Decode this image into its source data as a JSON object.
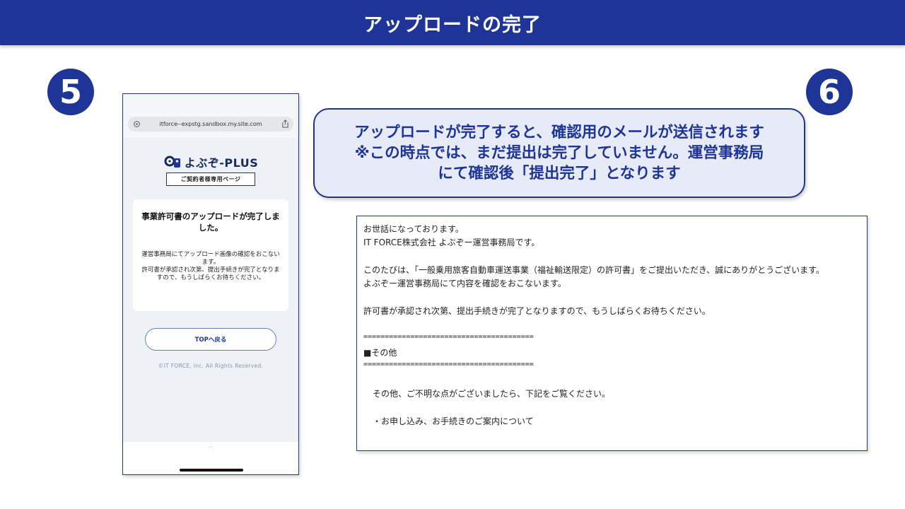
{
  "page": {
    "title": "アップロードの完了"
  },
  "badges": {
    "step5": "5",
    "step6": "6"
  },
  "phone": {
    "url": "itforce--expstg.sandbox.my.site.com",
    "logo": "よぶぞ-PLUS",
    "members_page": "ご契約者様専用ページ",
    "card_heading": "事業許可書のアップロードが完了しました。",
    "card_body": "運営事務局にてアップロード画像の確認をおこないます。\n許可書が承認され次第、提出手続きが完了となりますので、もうしばらくお待ちください。",
    "top_button": "TOPへ戻る",
    "copyright": "©IT FORCE, Inc. All Rights Reserved."
  },
  "callout": {
    "line1": "アップロードが完了すると、確認用のメールが送信されます",
    "line2": "※この時点では、まだ提出は完了していません。運営事務局",
    "line3": "にて確認後「提出完了」となります"
  },
  "email": {
    "l1": "お世話になっております。",
    "l2": "IT FORCE株式会社 よぶぞー運営事務局です。",
    "l3": "このたびは、「一般乗用旅客自動車運送事業（福祉輸送限定）の許可書」をご提出いただき、誠にありがとうございます。",
    "l4": "よぶぞー運営事務局にて内容を確認をおこないます。",
    "l5": "許可書が承認され次第、提出手続きが完了となりますので、もうしばらくお待ちください。",
    "sep": "========================================",
    "l6": "■その他",
    "l7": "その他、ご不明な点がございましたら、下記をご覧ください。",
    "l8": "・お申し込み、お手続きのご案内について"
  },
  "colors": {
    "brand": "#1e3497",
    "callout_bg": "#e7ebf8"
  }
}
